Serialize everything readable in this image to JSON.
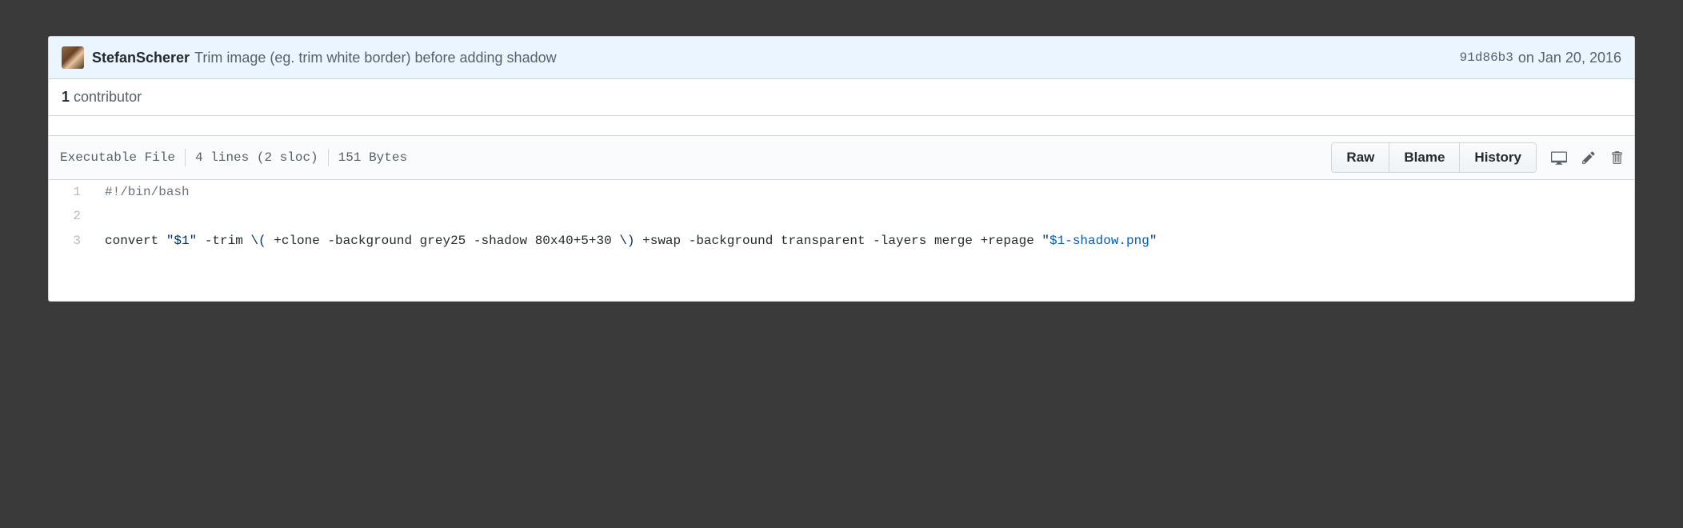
{
  "commit": {
    "author": "StefanScherer",
    "message": "Trim image (eg. trim white border) before adding shadow",
    "hash": "91d86b3",
    "date": "on Jan 20, 2016"
  },
  "contributors": {
    "count": "1",
    "label": "contributor"
  },
  "fileinfo": {
    "mode": "Executable File",
    "lines": "4 lines (2 sloc)",
    "size": "151 Bytes"
  },
  "toolbar": {
    "raw": "Raw",
    "blame": "Blame",
    "history": "History"
  },
  "code": {
    "lines": [
      {
        "n": "1",
        "html": "<span class='pl-c'>#!/bin/bash</span>"
      },
      {
        "n": "2",
        "html": ""
      },
      {
        "n": "3",
        "html": "convert <span class='pl-s'>\"$1\"</span> -trim <span class='pl-s'>\\(</span> +clone -background grey25 -shadow 80x40+5+30 <span class='pl-s'>\\)</span> +swap -background transparent -layers merge +repage <span class='pl-s'>\"</span><span class='pl-v'>$1-shadow.png</span><span class='pl-s'>\"</span>"
      }
    ]
  }
}
